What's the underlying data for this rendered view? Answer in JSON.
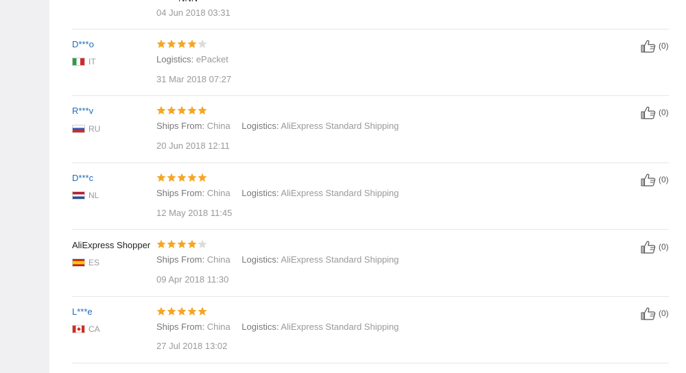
{
  "colors": {
    "star_filled": "#f5a623",
    "star_empty": "#dcdcdc",
    "username": "#1f6bb5",
    "muted": "#999999"
  },
  "stub_review": {
    "date": "04 Jun 2018 03:31"
  },
  "labels": {
    "ships_from": "Ships From:",
    "logistics": "Logistics:"
  },
  "reviews": [
    {
      "user": "D***o",
      "country": "IT",
      "flag": "italy-flag-icon",
      "rating": 4,
      "ships_from": "",
      "logistics": "ePacket",
      "date": "31 Mar 2018 07:27",
      "likes": "(0)"
    },
    {
      "user": "R***v",
      "country": "RU",
      "flag": "russia-flag-icon",
      "rating": 5,
      "ships_from": "China",
      "logistics": "AliExpress Standard Shipping",
      "date": "20 Jun 2018 12:11",
      "likes": "(0)"
    },
    {
      "user": "D***c",
      "country": "NL",
      "flag": "netherlands-flag-icon",
      "rating": 5,
      "ships_from": "China",
      "logistics": "AliExpress Standard Shipping",
      "date": "12 May 2018 11:45",
      "likes": "(0)"
    },
    {
      "user": "AliExpress Shopper",
      "country": "ES",
      "flag": "spain-flag-icon",
      "rating": 4,
      "ships_from": "China",
      "logistics": "AliExpress Standard Shipping",
      "date": "09 Apr 2018 11:30",
      "likes": "(0)"
    },
    {
      "user": "L***e",
      "country": "CA",
      "flag": "canada-flag-icon",
      "rating": 5,
      "ships_from": "China",
      "logistics": "AliExpress Standard Shipping",
      "date": "27 Jul 2018 13:02",
      "likes": "(0)"
    }
  ]
}
